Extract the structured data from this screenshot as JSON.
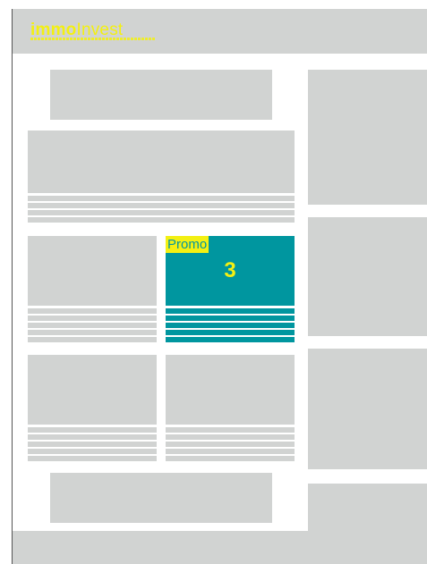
{
  "header": {
    "logo_bold": "immo",
    "logo_light": "Invest"
  },
  "promo": {
    "label": "Promo",
    "number": "3"
  },
  "colors": {
    "background": "#ffffff",
    "placeholder": "#d1d3d2",
    "accent_teal": "#00969f",
    "accent_yellow": "#f3f012"
  }
}
